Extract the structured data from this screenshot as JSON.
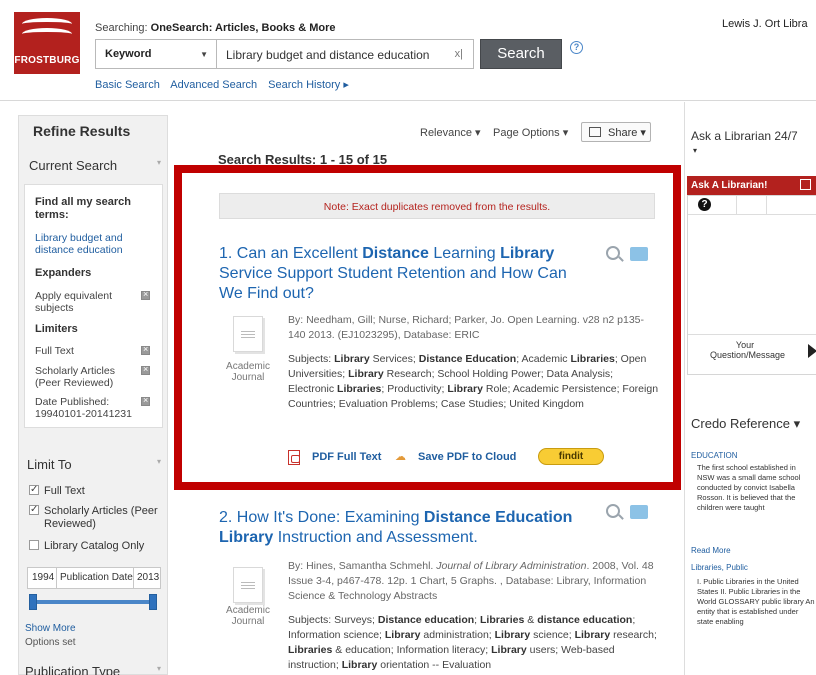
{
  "header": {
    "logo_text": "FROSTBURG",
    "searching_prefix": "Searching:",
    "searching_target": "OneSearch: Articles, Books & More",
    "org_name": "Lewis J. Ort Libra",
    "field_select": "Keyword",
    "query": "Library budget and distance education",
    "clear_label": "x|",
    "search_button": "Search",
    "help_label": "?",
    "links": [
      "Basic Search",
      "Advanced Search",
      "Search History ▸"
    ]
  },
  "left": {
    "refine_title": "Refine Results",
    "current_search_title": "Current Search",
    "find_label": "Find all my search terms:",
    "search_term": "Library budget and distance education",
    "expanders_heading": "Expanders",
    "expander_item": "Apply equivalent subjects",
    "limiters_heading": "Limiters",
    "limiters": [
      "Full Text",
      "Scholarly Articles (Peer Reviewed)",
      "Date Published: 19940101-20141231"
    ],
    "limit_to_title": "Limit To",
    "limit_full_text": "Full Text",
    "limit_scholarly": "Scholarly Articles (Peer",
    "limit_scholarly_2": "Reviewed)",
    "limit_catalog": "Library Catalog Only",
    "date_from": "1994",
    "date_label": "Publication Date",
    "date_to": "2013",
    "show_more": "Show More",
    "options_set": "Options set",
    "pub_type_title": "Publication Type"
  },
  "toolbar": {
    "relevance": "Relevance ▾",
    "page_options": "Page Options ▾",
    "share": "Share ▾"
  },
  "results": {
    "heading": "Search Results: 1 - 15 of 15",
    "note": "Note: Exact duplicates removed from the results.",
    "item1": {
      "title": "1. Can an Excellent Distance Learning Library Service Support Student Retention and How Can We Find out?",
      "doc_type": "Academic Journal",
      "byline": "By: Needham, Gill; Nurse, Richard; Parker, Jo. Open Learning. v28 n2 p135-140 2013. (EJ1023295), Database: ERIC",
      "subjects": "Subjects: Library Services; Distance Education; Academic Libraries; Open Universities; Library Research; School Holding Power; Data Analysis; Electronic Libraries; Productivity; Library Role; Academic Persistence; Foreign Countries; Evaluation Problems; Case Studies; United Kingdom",
      "pdf_link": "PDF Full Text",
      "cloud_link": "Save PDF to Cloud",
      "findit": "findit"
    },
    "item2": {
      "title": "2. How It's Done: Examining Distance Education Library Instruction and Assessment.",
      "doc_type": "Academic Journal",
      "byline": "By: Hines, Samantha Schmehl. Journal of Library Administration. 2008, Vol. 48 Issue 3-4, p467-478. 12p. 1 Chart, 5 Graphs. , Database: Library, Information Science & Technology Abstracts",
      "subjects": "Subjects: Surveys; Distance education; Libraries & distance education; Information science; Library administration; Library science; Library research; Libraries & education; Information literacy; Library users; Web-based instruction; Library orientation -- Evaluation"
    }
  },
  "right": {
    "ask_head": "Ask a Librarian 24/7",
    "ask_caret": "▾",
    "ask_bar": "Ask A Librarian!",
    "question_icon": "?",
    "message_label": "Your Question/Message",
    "credo_head": "Credo Reference ▾",
    "credo_link1": "EDUCATION",
    "credo_text1": "The first school established in NSW was a small dame school conducted by convict Isabella Rosson. It is believed that the children were taught",
    "credo_read_more": "Read More",
    "credo_link2": "Libraries, Public",
    "credo_text2": "I. Public Libraries in the United States II. Public Libraries in the World GLOSSARY public library An entity that is established under state enabling"
  },
  "colors": {
    "brand_red": "#b3211e",
    "link_blue": "#1d65b0",
    "highlight_red": "#c00000",
    "findit_yellow": "#f8cc34"
  }
}
